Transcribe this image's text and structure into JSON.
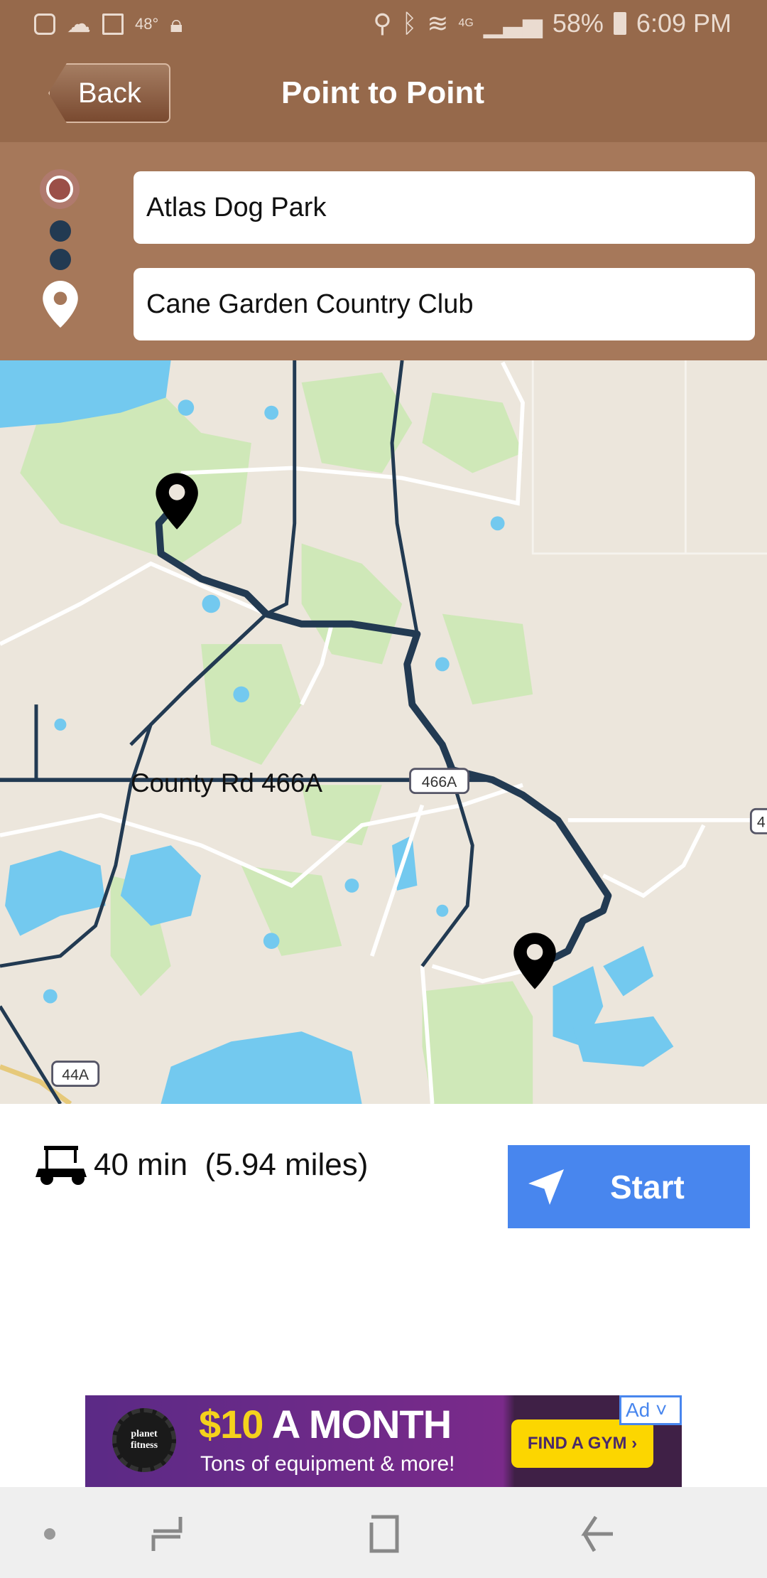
{
  "status_bar": {
    "temperature": "48°",
    "network": "4G",
    "battery": "58%",
    "time": "6:09 PM"
  },
  "header": {
    "back_label": "Back",
    "title": "Point to Point"
  },
  "route": {
    "origin": "Atlas Dog Park",
    "destination": "Cane Garden Country Club"
  },
  "map": {
    "road_label": "County Rd 466A",
    "shields": [
      "466A",
      "44A",
      "4"
    ]
  },
  "trip": {
    "vehicle_icon": "golf-cart-icon",
    "summary": "40 min  (5.94 miles)",
    "start_label": "Start"
  },
  "ad": {
    "badge": "Ad",
    "brand": "planet fitness",
    "headline_price": "$10",
    "headline_rest": " A MONTH",
    "subline": "Tons of equipment & more!",
    "cta": "FIND A GYM ›"
  },
  "colors": {
    "header": "#96694b",
    "panel": "#a6785a",
    "route": "#223a52",
    "start_button": "#4886ee"
  }
}
